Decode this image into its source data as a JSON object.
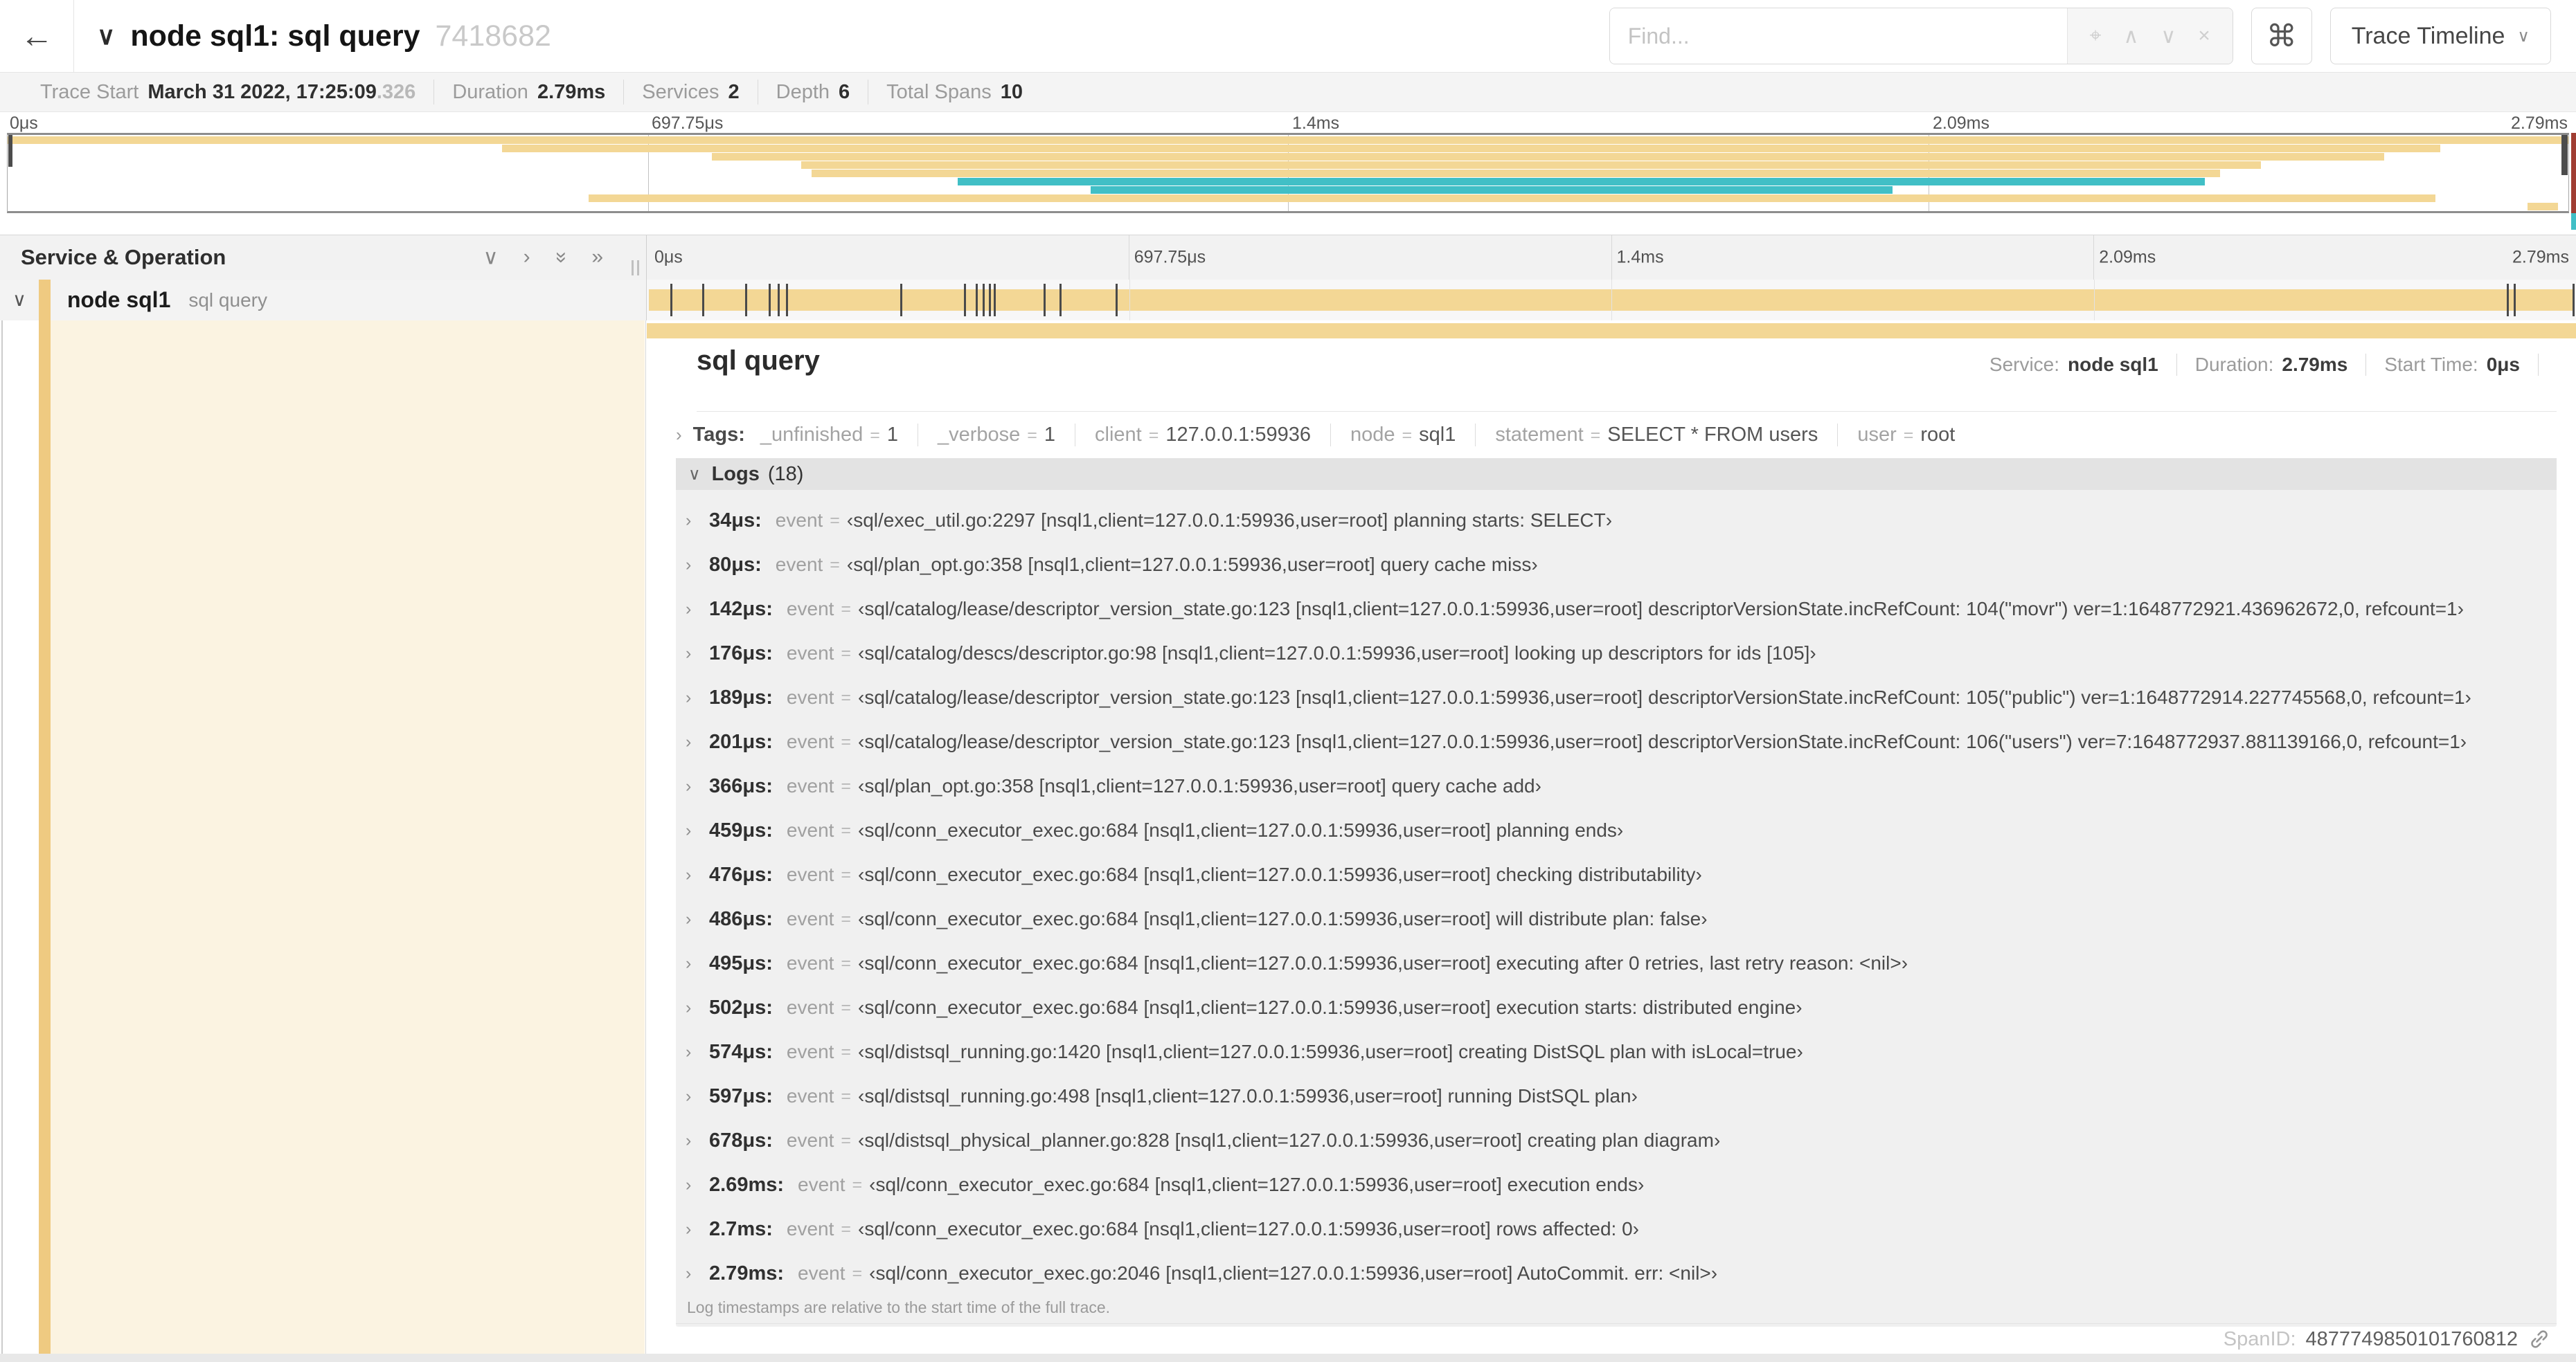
{
  "topnav": {
    "back_icon": "←",
    "collapse_icon": "∨",
    "title": "node sql1: sql query",
    "trace_id": "7418682",
    "find_placeholder": "Find...",
    "locate_icon": "⌖",
    "prev_icon": "∧",
    "next_icon": "∨",
    "clear_icon": "×",
    "shortcuts_icon": "⌘",
    "view_select": "Trace Timeline",
    "view_chevron": "∨"
  },
  "summary": {
    "items": [
      {
        "label": "Trace Start",
        "value": "March 31 2022, 17:25:09",
        "suffix": ".326"
      },
      {
        "label": "Duration",
        "value": "2.79ms"
      },
      {
        "label": "Services",
        "value": "2"
      },
      {
        "label": "Depth",
        "value": "6"
      },
      {
        "label": "Total Spans",
        "value": "10"
      }
    ]
  },
  "minimap": {
    "spans": [
      {
        "row": 0,
        "start_pct": 0,
        "width_pct": 100,
        "color": "#f3d795"
      },
      {
        "row": 1,
        "start_pct": 19.3,
        "width_pct": 75.7,
        "color": "#f3d795"
      },
      {
        "row": 2,
        "start_pct": 27.5,
        "width_pct": 65.3,
        "color": "#f3d795"
      },
      {
        "row": 3,
        "start_pct": 31,
        "width_pct": 57,
        "color": "#f3d795"
      },
      {
        "row": 4,
        "start_pct": 31.4,
        "width_pct": 55,
        "color": "#f3d795"
      },
      {
        "row": 5,
        "start_pct": 37.1,
        "width_pct": 48.7,
        "color": "#41bfc6"
      },
      {
        "row": 6,
        "start_pct": 42.3,
        "width_pct": 31.3,
        "color": "#41bfc6"
      },
      {
        "row": 7,
        "start_pct": 22.7,
        "width_pct": 72.1,
        "color": "#f3d795"
      },
      {
        "row": 8,
        "start_pct": 98.4,
        "width_pct": 1.2,
        "color": "#f3d795"
      }
    ]
  },
  "timeline": {
    "left_header": "Service & Operation",
    "icons": {
      "collapse_one": "∨",
      "expand_one": "›",
      "collapse_all": "»",
      "expand_all": "»"
    },
    "ticks": [
      {
        "pct": 0,
        "label": "0μs"
      },
      {
        "pct": 25,
        "label": "697.75μs"
      },
      {
        "pct": 50,
        "label": "1.4ms"
      },
      {
        "pct": 75,
        "label": "2.09ms"
      },
      {
        "pct": 100,
        "label": "2.79ms"
      }
    ],
    "row": {
      "collapse_icon": "∨",
      "service": "node sql1",
      "operation": "sql query"
    },
    "log_marker_pcts": [
      1.22,
      2.87,
      5.09,
      6.31,
      6.77,
      7.2,
      13.12,
      16.45,
      17.06,
      17.42,
      17.74,
      17.99,
      20.57,
      21.4,
      24.3,
      96.42,
      96.77,
      100
    ],
    "span_color": "#f3d795"
  },
  "detail": {
    "title": "sql query",
    "meta": [
      {
        "label": "Service:",
        "value": "node sql1"
      },
      {
        "label": "Duration:",
        "value": "2.79ms"
      },
      {
        "label": "Start Time:",
        "value": "0μs"
      }
    ],
    "tags": {
      "chevron": "›",
      "label": "Tags:",
      "items": [
        {
          "key": "_unfinished",
          "eq": "=",
          "value": "1"
        },
        {
          "key": "_verbose",
          "eq": "=",
          "value": "1"
        },
        {
          "key": "client",
          "eq": "=",
          "value": "127.0.0.1:59936"
        },
        {
          "key": "node",
          "eq": "=",
          "value": "sql1"
        },
        {
          "key": "statement",
          "eq": "=",
          "value": "SELECT * FROM users"
        },
        {
          "key": "user",
          "eq": "=",
          "value": "root"
        }
      ]
    },
    "logs": {
      "chevron": "∨",
      "label": "Logs",
      "count": "(18)",
      "entries": [
        {
          "chevron": "›",
          "t": "34μs:",
          "field": "event",
          "eq": "=",
          "value": "‹sql/exec_util.go:2297 [nsql1,client=127.0.0.1:59936,user=root] planning starts: SELECT›"
        },
        {
          "chevron": "›",
          "t": "80μs:",
          "field": "event",
          "eq": "=",
          "value": "‹sql/plan_opt.go:358 [nsql1,client=127.0.0.1:59936,user=root] query cache miss›"
        },
        {
          "chevron": "›",
          "t": "142μs:",
          "field": "event",
          "eq": "=",
          "value": "‹sql/catalog/lease/descriptor_version_state.go:123 [nsql1,client=127.0.0.1:59936,user=root] descriptorVersionState.incRefCount: 104(\"movr\") ver=1:1648772921.436962672,0, refcount=1›"
        },
        {
          "chevron": "›",
          "t": "176μs:",
          "field": "event",
          "eq": "=",
          "value": "‹sql/catalog/descs/descriptor.go:98 [nsql1,client=127.0.0.1:59936,user=root] looking up descriptors for ids [105]›"
        },
        {
          "chevron": "›",
          "t": "189μs:",
          "field": "event",
          "eq": "=",
          "value": "‹sql/catalog/lease/descriptor_version_state.go:123 [nsql1,client=127.0.0.1:59936,user=root] descriptorVersionState.incRefCount: 105(\"public\") ver=1:1648772914.227745568,0, refcount=1›"
        },
        {
          "chevron": "›",
          "t": "201μs:",
          "field": "event",
          "eq": "=",
          "value": "‹sql/catalog/lease/descriptor_version_state.go:123 [nsql1,client=127.0.0.1:59936,user=root] descriptorVersionState.incRefCount: 106(\"users\") ver=7:1648772937.881139166,0, refcount=1›"
        },
        {
          "chevron": "›",
          "t": "366μs:",
          "field": "event",
          "eq": "=",
          "value": "‹sql/plan_opt.go:358 [nsql1,client=127.0.0.1:59936,user=root] query cache add›"
        },
        {
          "chevron": "›",
          "t": "459μs:",
          "field": "event",
          "eq": "=",
          "value": "‹sql/conn_executor_exec.go:684 [nsql1,client=127.0.0.1:59936,user=root] planning ends›"
        },
        {
          "chevron": "›",
          "t": "476μs:",
          "field": "event",
          "eq": "=",
          "value": "‹sql/conn_executor_exec.go:684 [nsql1,client=127.0.0.1:59936,user=root] checking distributability›"
        },
        {
          "chevron": "›",
          "t": "486μs:",
          "field": "event",
          "eq": "=",
          "value": "‹sql/conn_executor_exec.go:684 [nsql1,client=127.0.0.1:59936,user=root] will distribute plan: false›"
        },
        {
          "chevron": "›",
          "t": "495μs:",
          "field": "event",
          "eq": "=",
          "value": "‹sql/conn_executor_exec.go:684 [nsql1,client=127.0.0.1:59936,user=root] executing after 0 retries, last retry reason: <nil>›"
        },
        {
          "chevron": "›",
          "t": "502μs:",
          "field": "event",
          "eq": "=",
          "value": "‹sql/conn_executor_exec.go:684 [nsql1,client=127.0.0.1:59936,user=root] execution starts: distributed engine›"
        },
        {
          "chevron": "›",
          "t": "574μs:",
          "field": "event",
          "eq": "=",
          "value": "‹sql/distsql_running.go:1420 [nsql1,client=127.0.0.1:59936,user=root] creating DistSQL plan with isLocal=true›"
        },
        {
          "chevron": "›",
          "t": "597μs:",
          "field": "event",
          "eq": "=",
          "value": "‹sql/distsql_running.go:498 [nsql1,client=127.0.0.1:59936,user=root] running DistSQL plan›"
        },
        {
          "chevron": "›",
          "t": "678μs:",
          "field": "event",
          "eq": "=",
          "value": "‹sql/distsql_physical_planner.go:828 [nsql1,client=127.0.0.1:59936,user=root] creating plan diagram›"
        },
        {
          "chevron": "›",
          "t": "2.69ms:",
          "field": "event",
          "eq": "=",
          "value": "‹sql/conn_executor_exec.go:684 [nsql1,client=127.0.0.1:59936,user=root] execution ends›"
        },
        {
          "chevron": "›",
          "t": "2.7ms:",
          "field": "event",
          "eq": "=",
          "value": "‹sql/conn_executor_exec.go:684 [nsql1,client=127.0.0.1:59936,user=root] rows affected: 0›"
        },
        {
          "chevron": "›",
          "t": "2.79ms:",
          "field": "event",
          "eq": "=",
          "value": "‹sql/conn_executor_exec.go:2046 [nsql1,client=127.0.0.1:59936,user=root] AutoCommit. err: <nil>›"
        }
      ],
      "note": "Log timestamps are relative to the start time of the full trace."
    },
    "footer": {
      "label": "SpanID:",
      "value": "4877749850101760812"
    }
  }
}
